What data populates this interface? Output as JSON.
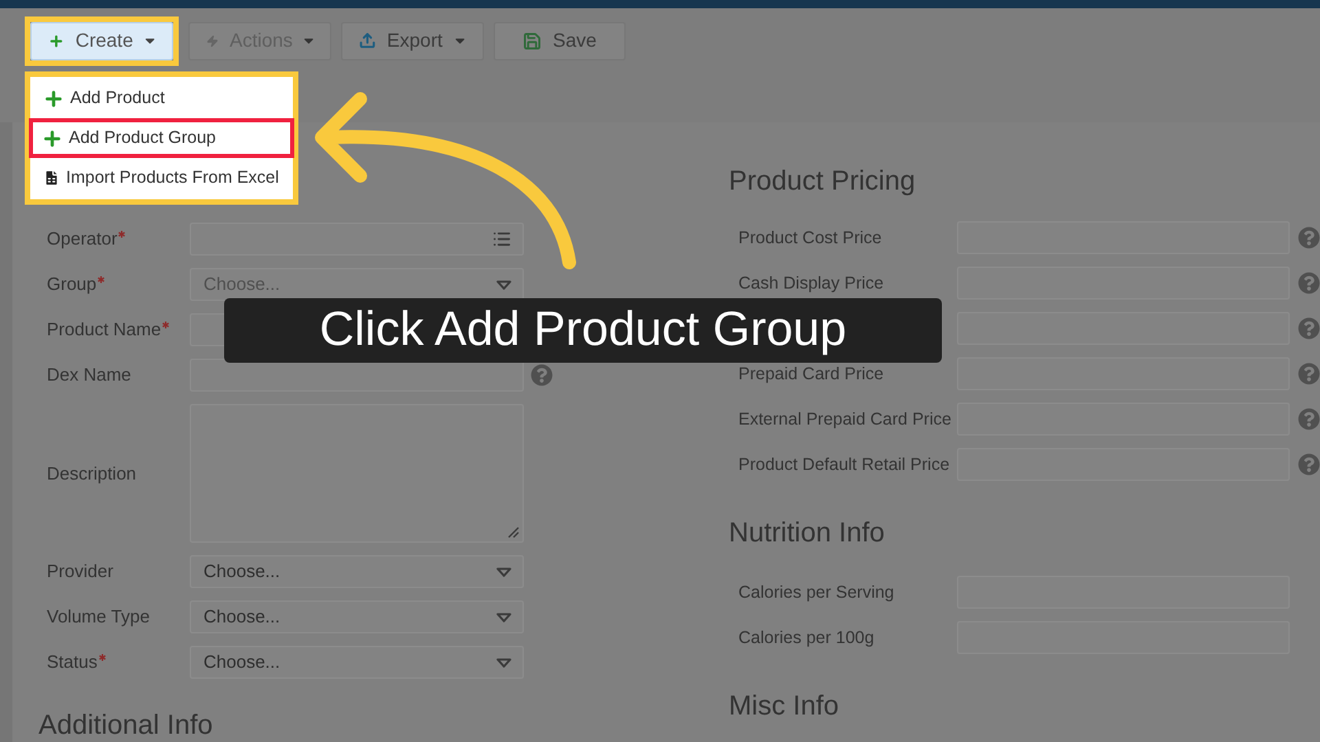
{
  "toolbar": {
    "buttons": [
      {
        "label": "Create",
        "menu": true,
        "highlighted": true,
        "disabled": false
      },
      {
        "label": "Actions",
        "menu": true,
        "highlighted": false,
        "disabled": true
      },
      {
        "label": "Export",
        "menu": true,
        "highlighted": false,
        "disabled": false
      },
      {
        "label": "Save",
        "menu": false,
        "highlighted": false,
        "disabled": false
      }
    ]
  },
  "create_menu": {
    "items": [
      {
        "label": "Add Product",
        "kind": "add",
        "selected": false
      },
      {
        "label": "Add Product Group",
        "kind": "add",
        "selected": true
      },
      {
        "label": "Import Products From Excel",
        "kind": "import",
        "selected": false
      }
    ]
  },
  "form": {
    "fields": [
      {
        "label": "Operator",
        "required": true,
        "kind": "picker",
        "help": false
      },
      {
        "label": "Group",
        "required": true,
        "kind": "select",
        "placeholder": "Choose...",
        "help": false
      },
      {
        "label": "Product Name",
        "required": true,
        "kind": "text",
        "help": false
      },
      {
        "label": "Dex Name",
        "required": false,
        "kind": "text",
        "help": true
      },
      {
        "label": "Description",
        "required": false,
        "kind": "textarea",
        "help": false
      },
      {
        "label": "Provider",
        "required": false,
        "kind": "select",
        "value": "Choose...",
        "help": false
      },
      {
        "label": "Volume Type",
        "required": false,
        "kind": "select",
        "value": "Choose...",
        "help": false
      },
      {
        "label": "Status",
        "required": true,
        "kind": "select",
        "value": "Choose...",
        "help": false
      }
    ],
    "next_heading": "Additional Info"
  },
  "pricing": {
    "heading": "Product Pricing",
    "fields": [
      {
        "label": "Product Cost Price",
        "help": true
      },
      {
        "label": "Cash Display Price",
        "help": true
      },
      {
        "help": true
      },
      {
        "label": "Prepaid Card Price",
        "help": true
      },
      {
        "label": "External Prepaid Card Price",
        "help": true
      },
      {
        "label": "Product Default Retail Price",
        "help": true
      }
    ]
  },
  "nutrition": {
    "heading": "Nutrition Info",
    "fields": [
      {
        "label": "Calories per Serving",
        "help": false
      },
      {
        "label": "Calories per 100g",
        "help": false
      }
    ]
  },
  "misc": {
    "heading": "Misc Info"
  },
  "tutorial": {
    "caption": "Click Add Product Group"
  }
}
